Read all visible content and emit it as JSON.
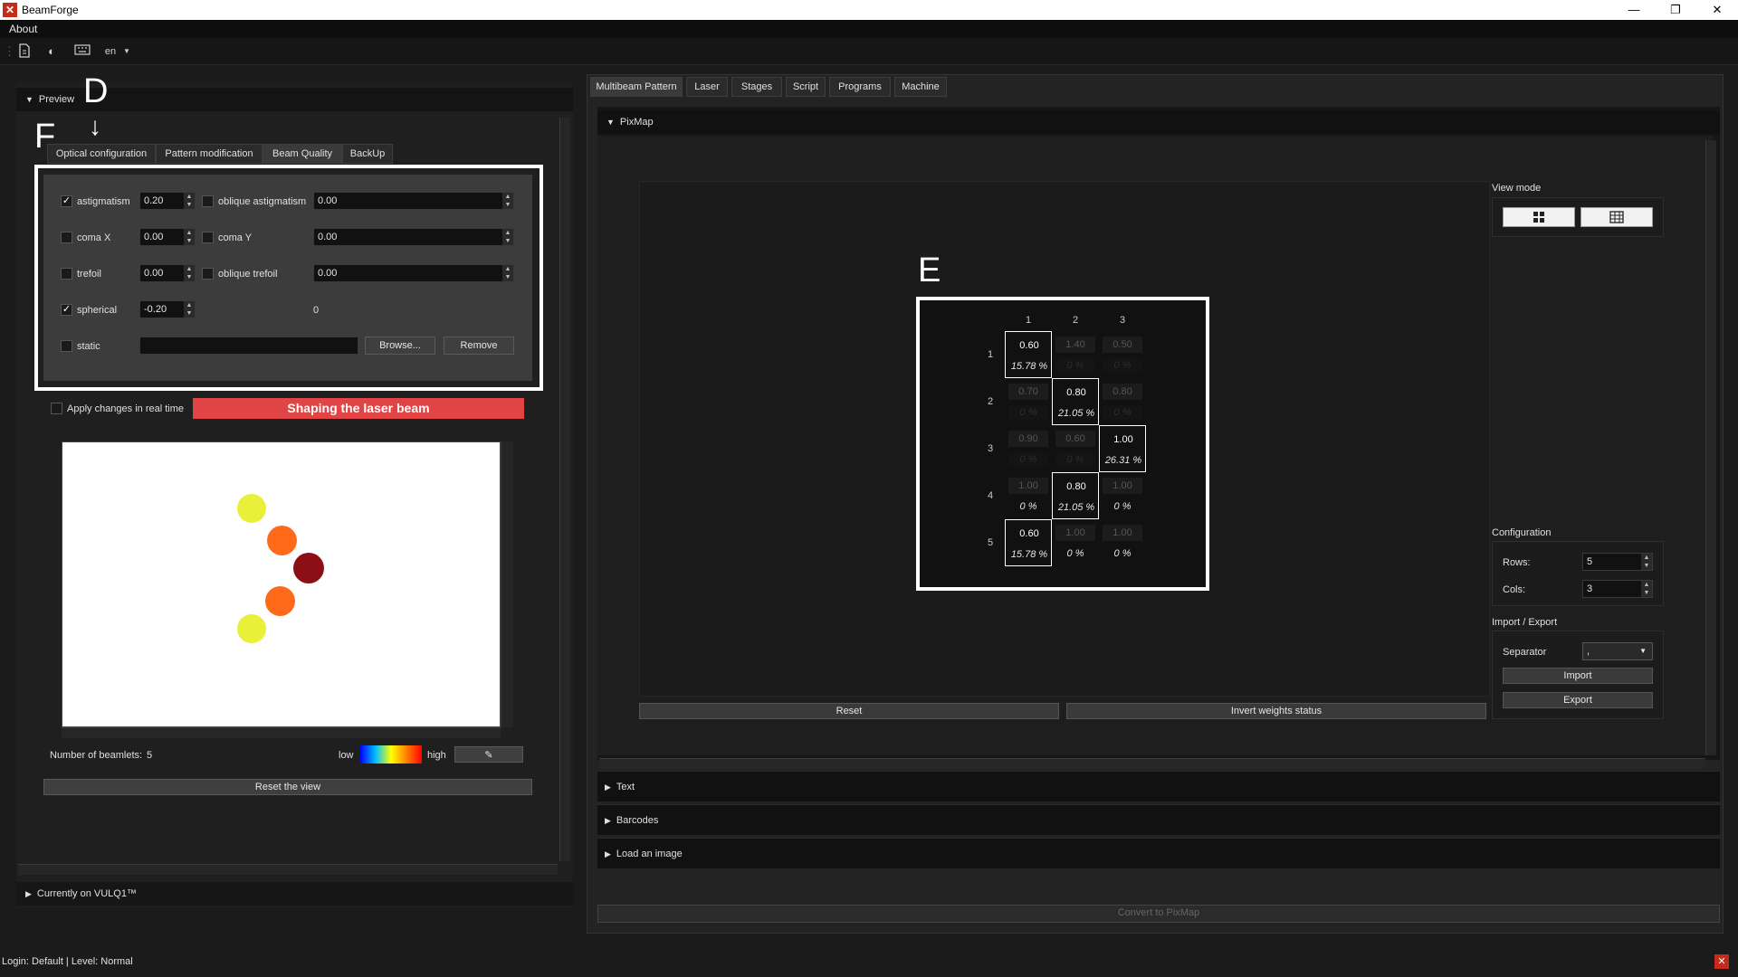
{
  "window": {
    "title": "BeamForge",
    "minimize": "—",
    "restore": "❐",
    "close": "✕"
  },
  "menu": {
    "about": "About"
  },
  "toolbar": {
    "language": "en"
  },
  "left": {
    "preview_header": "Preview",
    "annotations": {
      "d": "D",
      "f": "F",
      "arrow": "↓",
      "e": "E"
    },
    "tabs": [
      "Optical configuration",
      "Pattern modification",
      "Beam Quality",
      "BackUp"
    ],
    "beam_quality": {
      "rows": [
        {
          "checked": true,
          "label": "astigmatism",
          "value": "0.20",
          "pair_label": "oblique astigmatism",
          "pair_value": "0.00"
        },
        {
          "checked": false,
          "label": "coma X",
          "value": "0.00",
          "pair_label": "coma Y",
          "pair_value": "0.00"
        },
        {
          "checked": false,
          "label": "trefoil",
          "value": "0.00",
          "pair_label": "oblique trefoil",
          "pair_value": "0.00"
        },
        {
          "checked": true,
          "label": "spherical",
          "value": "-0.20",
          "readout": "0"
        }
      ],
      "static_label": "static",
      "browse": "Browse...",
      "remove": "Remove"
    },
    "apply_realtime": "Apply changes in real time",
    "shaping": "Shaping the laser beam",
    "beamlets_label": "Number of beamlets:",
    "beamlets_count": "5",
    "low": "low",
    "high": "high",
    "reset_view": "Reset the view",
    "currently_on": "Currently on VULQ1™",
    "beamlet_colors": [
      "#e9f03a",
      "#ff6a1a",
      "#8b0f14",
      "#ff6a1a",
      "#e9f03a"
    ]
  },
  "right": {
    "tabs": [
      "Multibeam Pattern",
      "Laser",
      "Stages",
      "Script",
      "Programs",
      "Machine"
    ],
    "pixmap_header": "PixMap",
    "view_mode": "View mode",
    "configuration": "Configuration",
    "rows_label": "Rows:",
    "rows_value": "5",
    "cols_label": "Cols:",
    "cols_value": "3",
    "import_export": "Import / Export",
    "separator_label": "Separator",
    "separator_value": ",",
    "import": "Import",
    "export": "Export",
    "reset": "Reset",
    "invert": "Invert weights status",
    "sections": [
      "Text",
      "Barcodes",
      "Load an image"
    ],
    "convert": "Convert to PixMap",
    "grid": {
      "col_headers": [
        "1",
        "2",
        "3"
      ],
      "row_headers": [
        "1",
        "2",
        "3",
        "4",
        "5"
      ],
      "cells": [
        [
          {
            "v": "0.60",
            "p": "15.78 %",
            "on": true
          },
          {
            "v": "1.40",
            "p": "0 %",
            "on": false
          },
          {
            "v": "0.50",
            "p": "0 %",
            "on": false
          }
        ],
        [
          {
            "v": "0.70",
            "p": "0 %",
            "on": false
          },
          {
            "v": "0.80",
            "p": "21.05 %",
            "on": true
          },
          {
            "v": "0.80",
            "p": "0 %",
            "on": false
          }
        ],
        [
          {
            "v": "0.90",
            "p": "0 %",
            "on": false
          },
          {
            "v": "0.60",
            "p": "0 %",
            "on": false
          },
          {
            "v": "1.00",
            "p": "26.31 %",
            "on": true
          }
        ],
        [
          {
            "v": "1.00",
            "p": "0 %",
            "on": false,
            "lit": true
          },
          {
            "v": "0.80",
            "p": "21.05 %",
            "on": true
          },
          {
            "v": "1.00",
            "p": "0 %",
            "on": false,
            "lit": true
          }
        ],
        [
          {
            "v": "0.60",
            "p": "15.78 %",
            "on": true
          },
          {
            "v": "1.00",
            "p": "0 %",
            "on": false,
            "lit": true
          },
          {
            "v": "1.00",
            "p": "0 %",
            "on": false,
            "lit": true
          }
        ]
      ]
    }
  },
  "status": {
    "login": "Login: Default | Level: Normal"
  }
}
